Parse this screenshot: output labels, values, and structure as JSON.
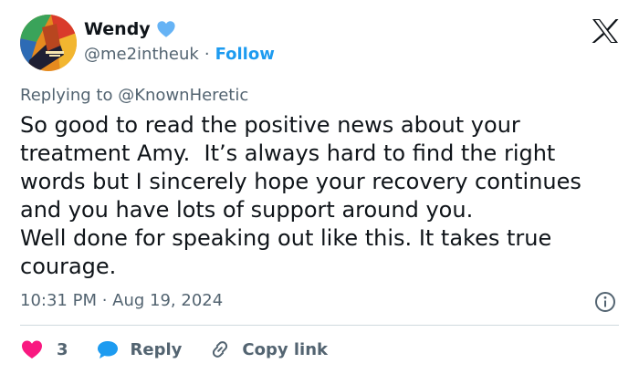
{
  "tweet": {
    "author_name": "Wendy",
    "handle": "@me2intheuk",
    "separator": "·",
    "follow_label": "Follow",
    "reply_prefix": "Replying to",
    "reply_mention": "@KnownHeretic",
    "body": "So good to read the positive news about your\ntreatment Amy.  It’s always hard to find the right\nwords but I sincerely hope your recovery continues\nand you have lots of support around you.\nWell done for speaking out like this. It takes true\ncourage.",
    "timestamp": "10:31 PM · Aug 19, 2024",
    "like_count": "3",
    "reply_label": "Reply",
    "copy_label": "Copy link"
  },
  "icons": {
    "verified": "verified-heart-icon",
    "brand": "x-logo-icon",
    "info": "info-icon",
    "like": "heart-icon",
    "reply": "speech-bubble-icon",
    "copy": "link-icon"
  },
  "colors": {
    "accent": "#1d9bf0",
    "heart": "#f91880",
    "muted": "#536471",
    "verified": "#66b3f5"
  }
}
